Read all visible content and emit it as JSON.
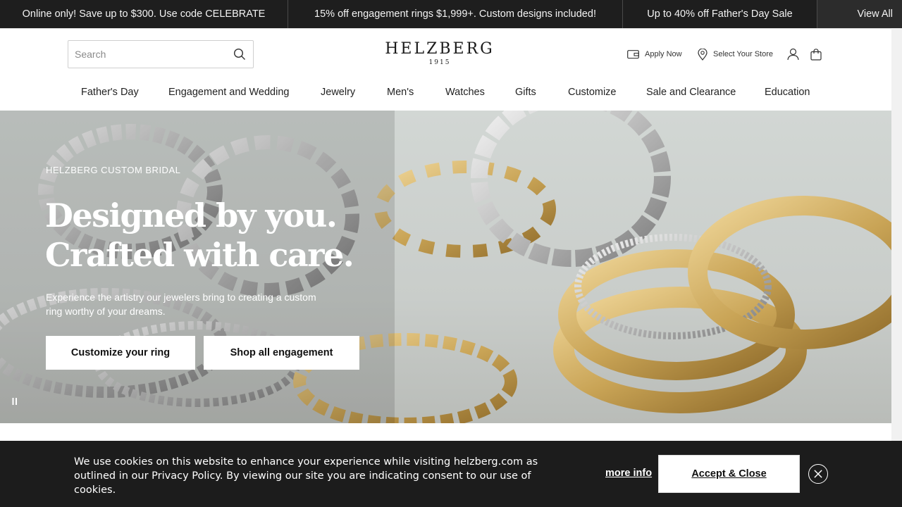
{
  "promos": [
    {
      "text": "Online only! Save up to $300. Use code CELEBRATE"
    },
    {
      "text": "15% off engagement rings $1,999+. Custom designs included!"
    },
    {
      "text": "Up to 40% off Father's Day Sale"
    }
  ],
  "promo_view_all": "View All",
  "search": {
    "placeholder": "Search"
  },
  "logo": {
    "name": "HELZBERG",
    "year": "1915"
  },
  "utility": {
    "apply": "Apply Now",
    "store": "Select Your Store"
  },
  "nav": [
    {
      "label": "Father's Day"
    },
    {
      "label": "Engagement and Wedding"
    },
    {
      "label": "Jewelry"
    },
    {
      "label": "Men's"
    },
    {
      "label": "Watches"
    },
    {
      "label": "Gifts"
    },
    {
      "label": "Customize"
    },
    {
      "label": "Sale and Clearance"
    },
    {
      "label": "Education"
    }
  ],
  "hero": {
    "eyebrow": "HELZBERG CUSTOM BRIDAL",
    "title_line1": "Designed by you.",
    "title_line2": "Crafted with care.",
    "subtitle": "Experience the artistry our jewelers bring to creating a custom ring worthy of your dreams.",
    "cta_customize": "Customize your ring",
    "cta_shop": "Shop all engagement"
  },
  "cookie": {
    "text": "We use cookies on this website to enhance your experience while visiting helzberg.com as outlined in our Privacy Policy. By viewing our site you are indicating consent to our use of cookies.",
    "more_info": "more info",
    "accept": "Accept & Close"
  },
  "colors": {
    "promo_bg": "#1e1e1e",
    "cookie_bg": "#1c1c1c",
    "hero_bg": "#cdd2d0",
    "gold": "#c9a456",
    "silver": "#d8d8d8"
  }
}
